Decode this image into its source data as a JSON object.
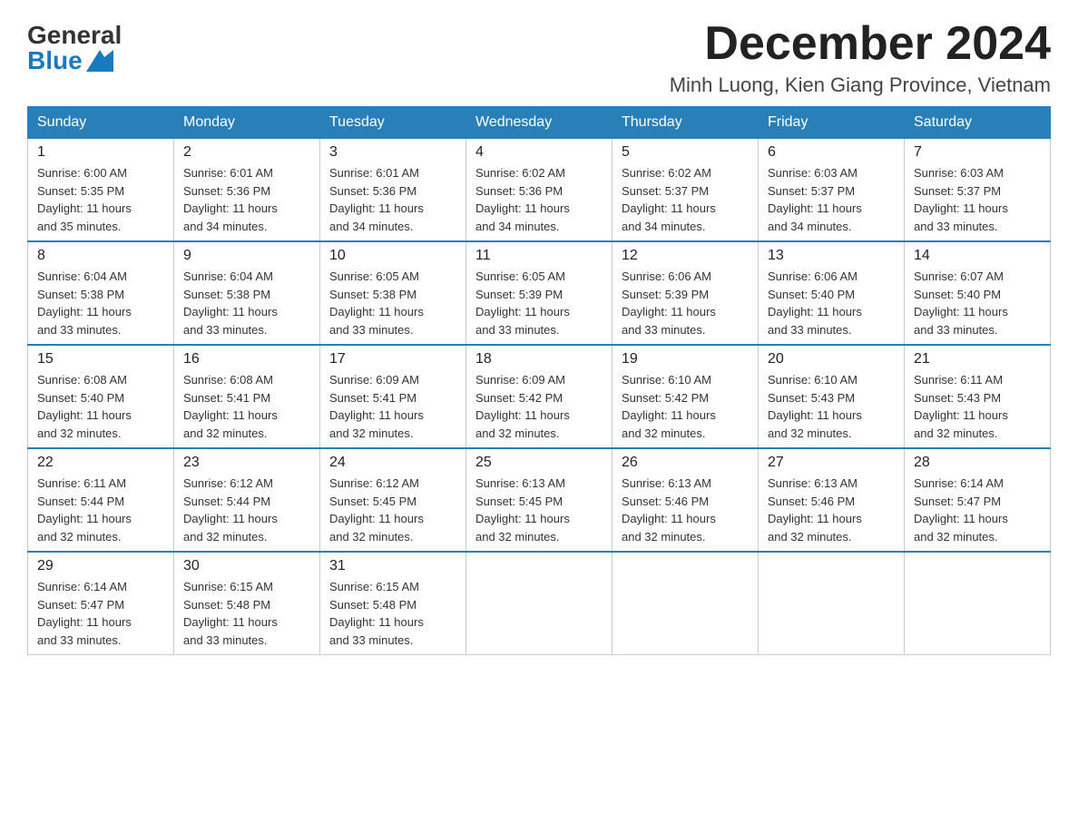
{
  "logo": {
    "general": "General",
    "blue": "Blue"
  },
  "title": "December 2024",
  "location": "Minh Luong, Kien Giang Province, Vietnam",
  "days_of_week": [
    "Sunday",
    "Monday",
    "Tuesday",
    "Wednesday",
    "Thursday",
    "Friday",
    "Saturday"
  ],
  "weeks": [
    [
      {
        "day": "1",
        "sunrise": "6:00 AM",
        "sunset": "5:35 PM",
        "daylight": "11 hours and 35 minutes."
      },
      {
        "day": "2",
        "sunrise": "6:01 AM",
        "sunset": "5:36 PM",
        "daylight": "11 hours and 34 minutes."
      },
      {
        "day": "3",
        "sunrise": "6:01 AM",
        "sunset": "5:36 PM",
        "daylight": "11 hours and 34 minutes."
      },
      {
        "day": "4",
        "sunrise": "6:02 AM",
        "sunset": "5:36 PM",
        "daylight": "11 hours and 34 minutes."
      },
      {
        "day": "5",
        "sunrise": "6:02 AM",
        "sunset": "5:37 PM",
        "daylight": "11 hours and 34 minutes."
      },
      {
        "day": "6",
        "sunrise": "6:03 AM",
        "sunset": "5:37 PM",
        "daylight": "11 hours and 34 minutes."
      },
      {
        "day": "7",
        "sunrise": "6:03 AM",
        "sunset": "5:37 PM",
        "daylight": "11 hours and 33 minutes."
      }
    ],
    [
      {
        "day": "8",
        "sunrise": "6:04 AM",
        "sunset": "5:38 PM",
        "daylight": "11 hours and 33 minutes."
      },
      {
        "day": "9",
        "sunrise": "6:04 AM",
        "sunset": "5:38 PM",
        "daylight": "11 hours and 33 minutes."
      },
      {
        "day": "10",
        "sunrise": "6:05 AM",
        "sunset": "5:38 PM",
        "daylight": "11 hours and 33 minutes."
      },
      {
        "day": "11",
        "sunrise": "6:05 AM",
        "sunset": "5:39 PM",
        "daylight": "11 hours and 33 minutes."
      },
      {
        "day": "12",
        "sunrise": "6:06 AM",
        "sunset": "5:39 PM",
        "daylight": "11 hours and 33 minutes."
      },
      {
        "day": "13",
        "sunrise": "6:06 AM",
        "sunset": "5:40 PM",
        "daylight": "11 hours and 33 minutes."
      },
      {
        "day": "14",
        "sunrise": "6:07 AM",
        "sunset": "5:40 PM",
        "daylight": "11 hours and 33 minutes."
      }
    ],
    [
      {
        "day": "15",
        "sunrise": "6:08 AM",
        "sunset": "5:40 PM",
        "daylight": "11 hours and 32 minutes."
      },
      {
        "day": "16",
        "sunrise": "6:08 AM",
        "sunset": "5:41 PM",
        "daylight": "11 hours and 32 minutes."
      },
      {
        "day": "17",
        "sunrise": "6:09 AM",
        "sunset": "5:41 PM",
        "daylight": "11 hours and 32 minutes."
      },
      {
        "day": "18",
        "sunrise": "6:09 AM",
        "sunset": "5:42 PM",
        "daylight": "11 hours and 32 minutes."
      },
      {
        "day": "19",
        "sunrise": "6:10 AM",
        "sunset": "5:42 PM",
        "daylight": "11 hours and 32 minutes."
      },
      {
        "day": "20",
        "sunrise": "6:10 AM",
        "sunset": "5:43 PM",
        "daylight": "11 hours and 32 minutes."
      },
      {
        "day": "21",
        "sunrise": "6:11 AM",
        "sunset": "5:43 PM",
        "daylight": "11 hours and 32 minutes."
      }
    ],
    [
      {
        "day": "22",
        "sunrise": "6:11 AM",
        "sunset": "5:44 PM",
        "daylight": "11 hours and 32 minutes."
      },
      {
        "day": "23",
        "sunrise": "6:12 AM",
        "sunset": "5:44 PM",
        "daylight": "11 hours and 32 minutes."
      },
      {
        "day": "24",
        "sunrise": "6:12 AM",
        "sunset": "5:45 PM",
        "daylight": "11 hours and 32 minutes."
      },
      {
        "day": "25",
        "sunrise": "6:13 AM",
        "sunset": "5:45 PM",
        "daylight": "11 hours and 32 minutes."
      },
      {
        "day": "26",
        "sunrise": "6:13 AM",
        "sunset": "5:46 PM",
        "daylight": "11 hours and 32 minutes."
      },
      {
        "day": "27",
        "sunrise": "6:13 AM",
        "sunset": "5:46 PM",
        "daylight": "11 hours and 32 minutes."
      },
      {
        "day": "28",
        "sunrise": "6:14 AM",
        "sunset": "5:47 PM",
        "daylight": "11 hours and 32 minutes."
      }
    ],
    [
      {
        "day": "29",
        "sunrise": "6:14 AM",
        "sunset": "5:47 PM",
        "daylight": "11 hours and 33 minutes."
      },
      {
        "day": "30",
        "sunrise": "6:15 AM",
        "sunset": "5:48 PM",
        "daylight": "11 hours and 33 minutes."
      },
      {
        "day": "31",
        "sunrise": "6:15 AM",
        "sunset": "5:48 PM",
        "daylight": "11 hours and 33 minutes."
      },
      null,
      null,
      null,
      null
    ]
  ]
}
